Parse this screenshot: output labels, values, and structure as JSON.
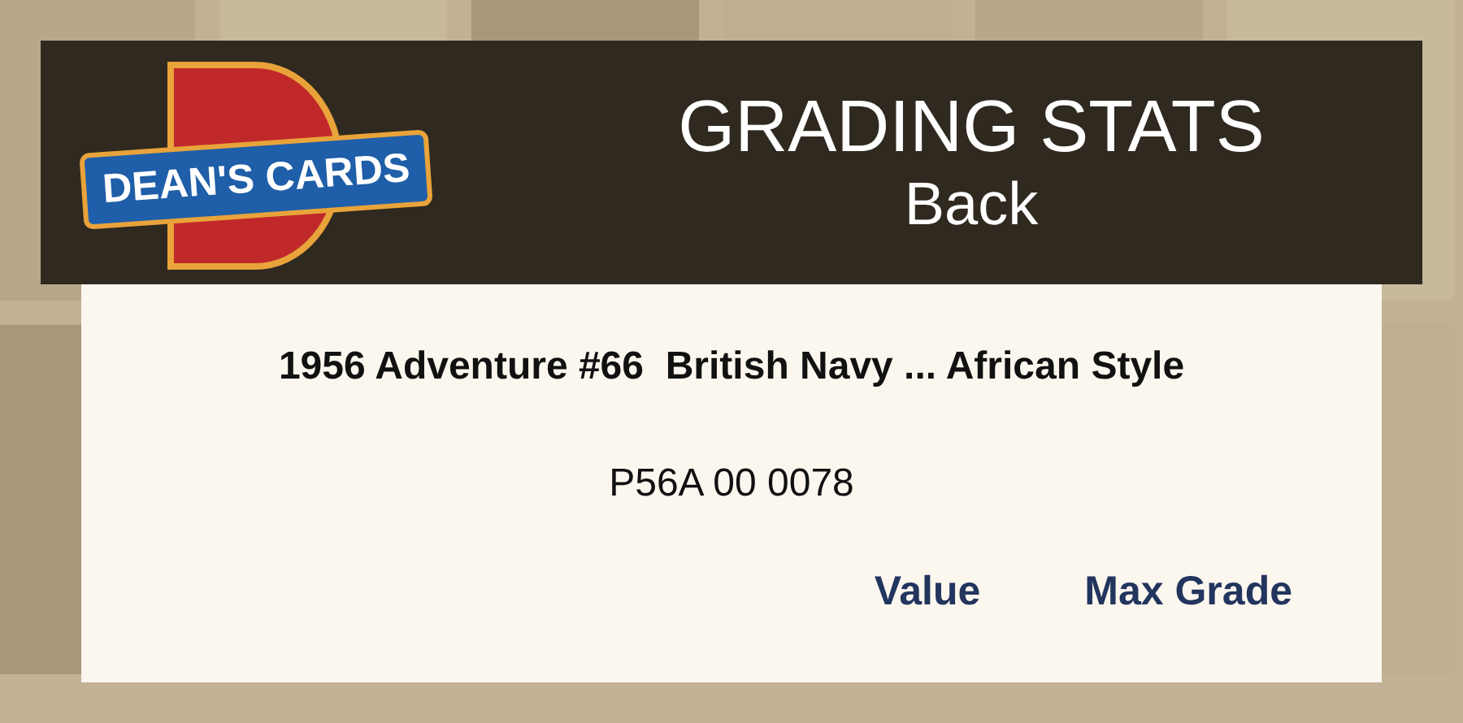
{
  "header": {
    "logo": {
      "name": "DEAN'S CARDS"
    },
    "title": "GRADING STATS",
    "subtitle": "Back"
  },
  "card": {
    "title": "1956 Adventure #66  British Navy ... African Style",
    "cert_number": "P56A 00 0078",
    "links": [
      {
        "label": "Value"
      },
      {
        "label": "Max Grade"
      }
    ]
  }
}
